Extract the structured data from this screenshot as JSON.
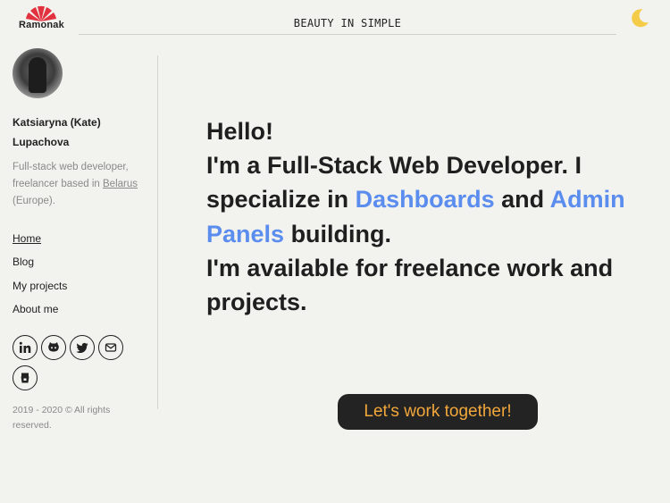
{
  "header": {
    "logo_text": "Ramonak",
    "tagline": "BEAUTY IN SIMPLE",
    "theme_toggle_icon": "moon-icon"
  },
  "sidebar": {
    "name_line1": "Katsiaryna (Kate)",
    "name_line2": "Lupachova",
    "bio_part1": "Full-stack web developer, freelancer based in ",
    "bio_link": "Belarus",
    "bio_part2": " (Europe).",
    "nav": [
      {
        "label": "Home"
      },
      {
        "label": "Blog"
      },
      {
        "label": "My projects"
      },
      {
        "label": "About me"
      }
    ],
    "socials": [
      "linkedin-icon",
      "github-icon",
      "twitter-icon",
      "mail-icon",
      "dev-icon"
    ],
    "copyright": "2019 - 2020 © All rights reserved."
  },
  "main": {
    "hero": {
      "greeting": "Hello!",
      "line1": "I'm a Full-Stack Web Developer. I specialize in ",
      "highlight1": "Dashboards",
      "and": " and ",
      "highlight2": "Admin Panels",
      "line2": " building.",
      "line3": "I'm available for freelance work and projects."
    },
    "cta_label": "Let's work together!"
  },
  "colors": {
    "background": "#f2f2ee",
    "accent_blue": "#5b8def",
    "cta_bg": "#232323",
    "cta_text": "#f2a73b",
    "logo_red": "#e2323f",
    "moon": "#f4cc4a"
  }
}
